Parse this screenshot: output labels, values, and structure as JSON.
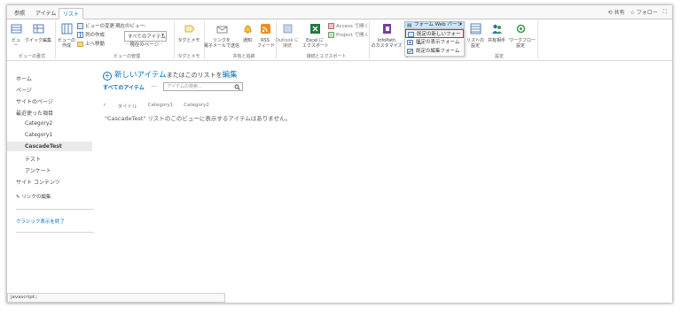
{
  "tabs": {
    "browse": "参照",
    "items": "アイテム",
    "list": "リスト"
  },
  "topright": {
    "share": "共有",
    "follow": "フォロー"
  },
  "ribbon": {
    "view": "ビュー",
    "quick_edit": "クイック編集",
    "view_format_group": "ビューの書式",
    "create_view": "ビューの\n作成",
    "modify_view": "ビューの変更",
    "create_column": "列の作成",
    "navigate_up": "上へ移動",
    "current_view_label": "現在のビュー:",
    "current_view_value": "すべてのアイテム",
    "current_page": "現在のページ",
    "manage_views_group": "ビューの管理",
    "tags_notes": "タグとメモ",
    "tags_group": "タグとメモ",
    "email_link": "リンクを\n電子メールで送信",
    "alert_me": "通知",
    "rss_feed": "RSS\nフィード",
    "share_track_group": "共有と追跡",
    "outlook_connect": "Outlook に\n接続",
    "excel_export": "Excel に\nエクスポート",
    "access_open": "Access で開く",
    "project_open": "Project で開く",
    "connect_export_group": "接続とエクスポート",
    "infopath": "InfoPath\nのカスタマイズ",
    "forms_web_parts": "フォーム Web パーツ",
    "list_settings": "リストの\n設定",
    "shared_with": "共有相手",
    "workflow_settings": "ワークフロー\n設定",
    "settings_group": "設定",
    "customize_group_partial": "リ"
  },
  "forms_menu": {
    "items": [
      "既定の新しいフォーム",
      "既定の表示フォーム",
      "既定の編集フォーム"
    ]
  },
  "nav": {
    "home": "ホーム",
    "page": "ページ",
    "site_pages": "サイトのページ",
    "recent": "最近使った項目",
    "category2": "Category2",
    "category1": "Category1",
    "cascade_test": "CascadeTest",
    "test": "テスト",
    "survey": "アンケート",
    "site_contents": "サイト コンテンツ",
    "edit_links": "リンクの編集",
    "exit_classic": "クラシック表示を終了"
  },
  "main": {
    "new_item": "新しいアイテム",
    "or_text": "またはこのリストを",
    "edit": "編集",
    "all_items": "すべてのアイテム",
    "more": "···",
    "search_placeholder": "アイテムの検索...",
    "headers": [
      "タイトル",
      "Category1",
      "Category2"
    ],
    "empty_message": "\"CascadeTest\" リストのこのビューに表示するアイテムはありません。"
  },
  "status": {
    "text": "javascript:;"
  },
  "colors": {
    "accent": "#0072c6",
    "highlight": "#d9262c"
  }
}
